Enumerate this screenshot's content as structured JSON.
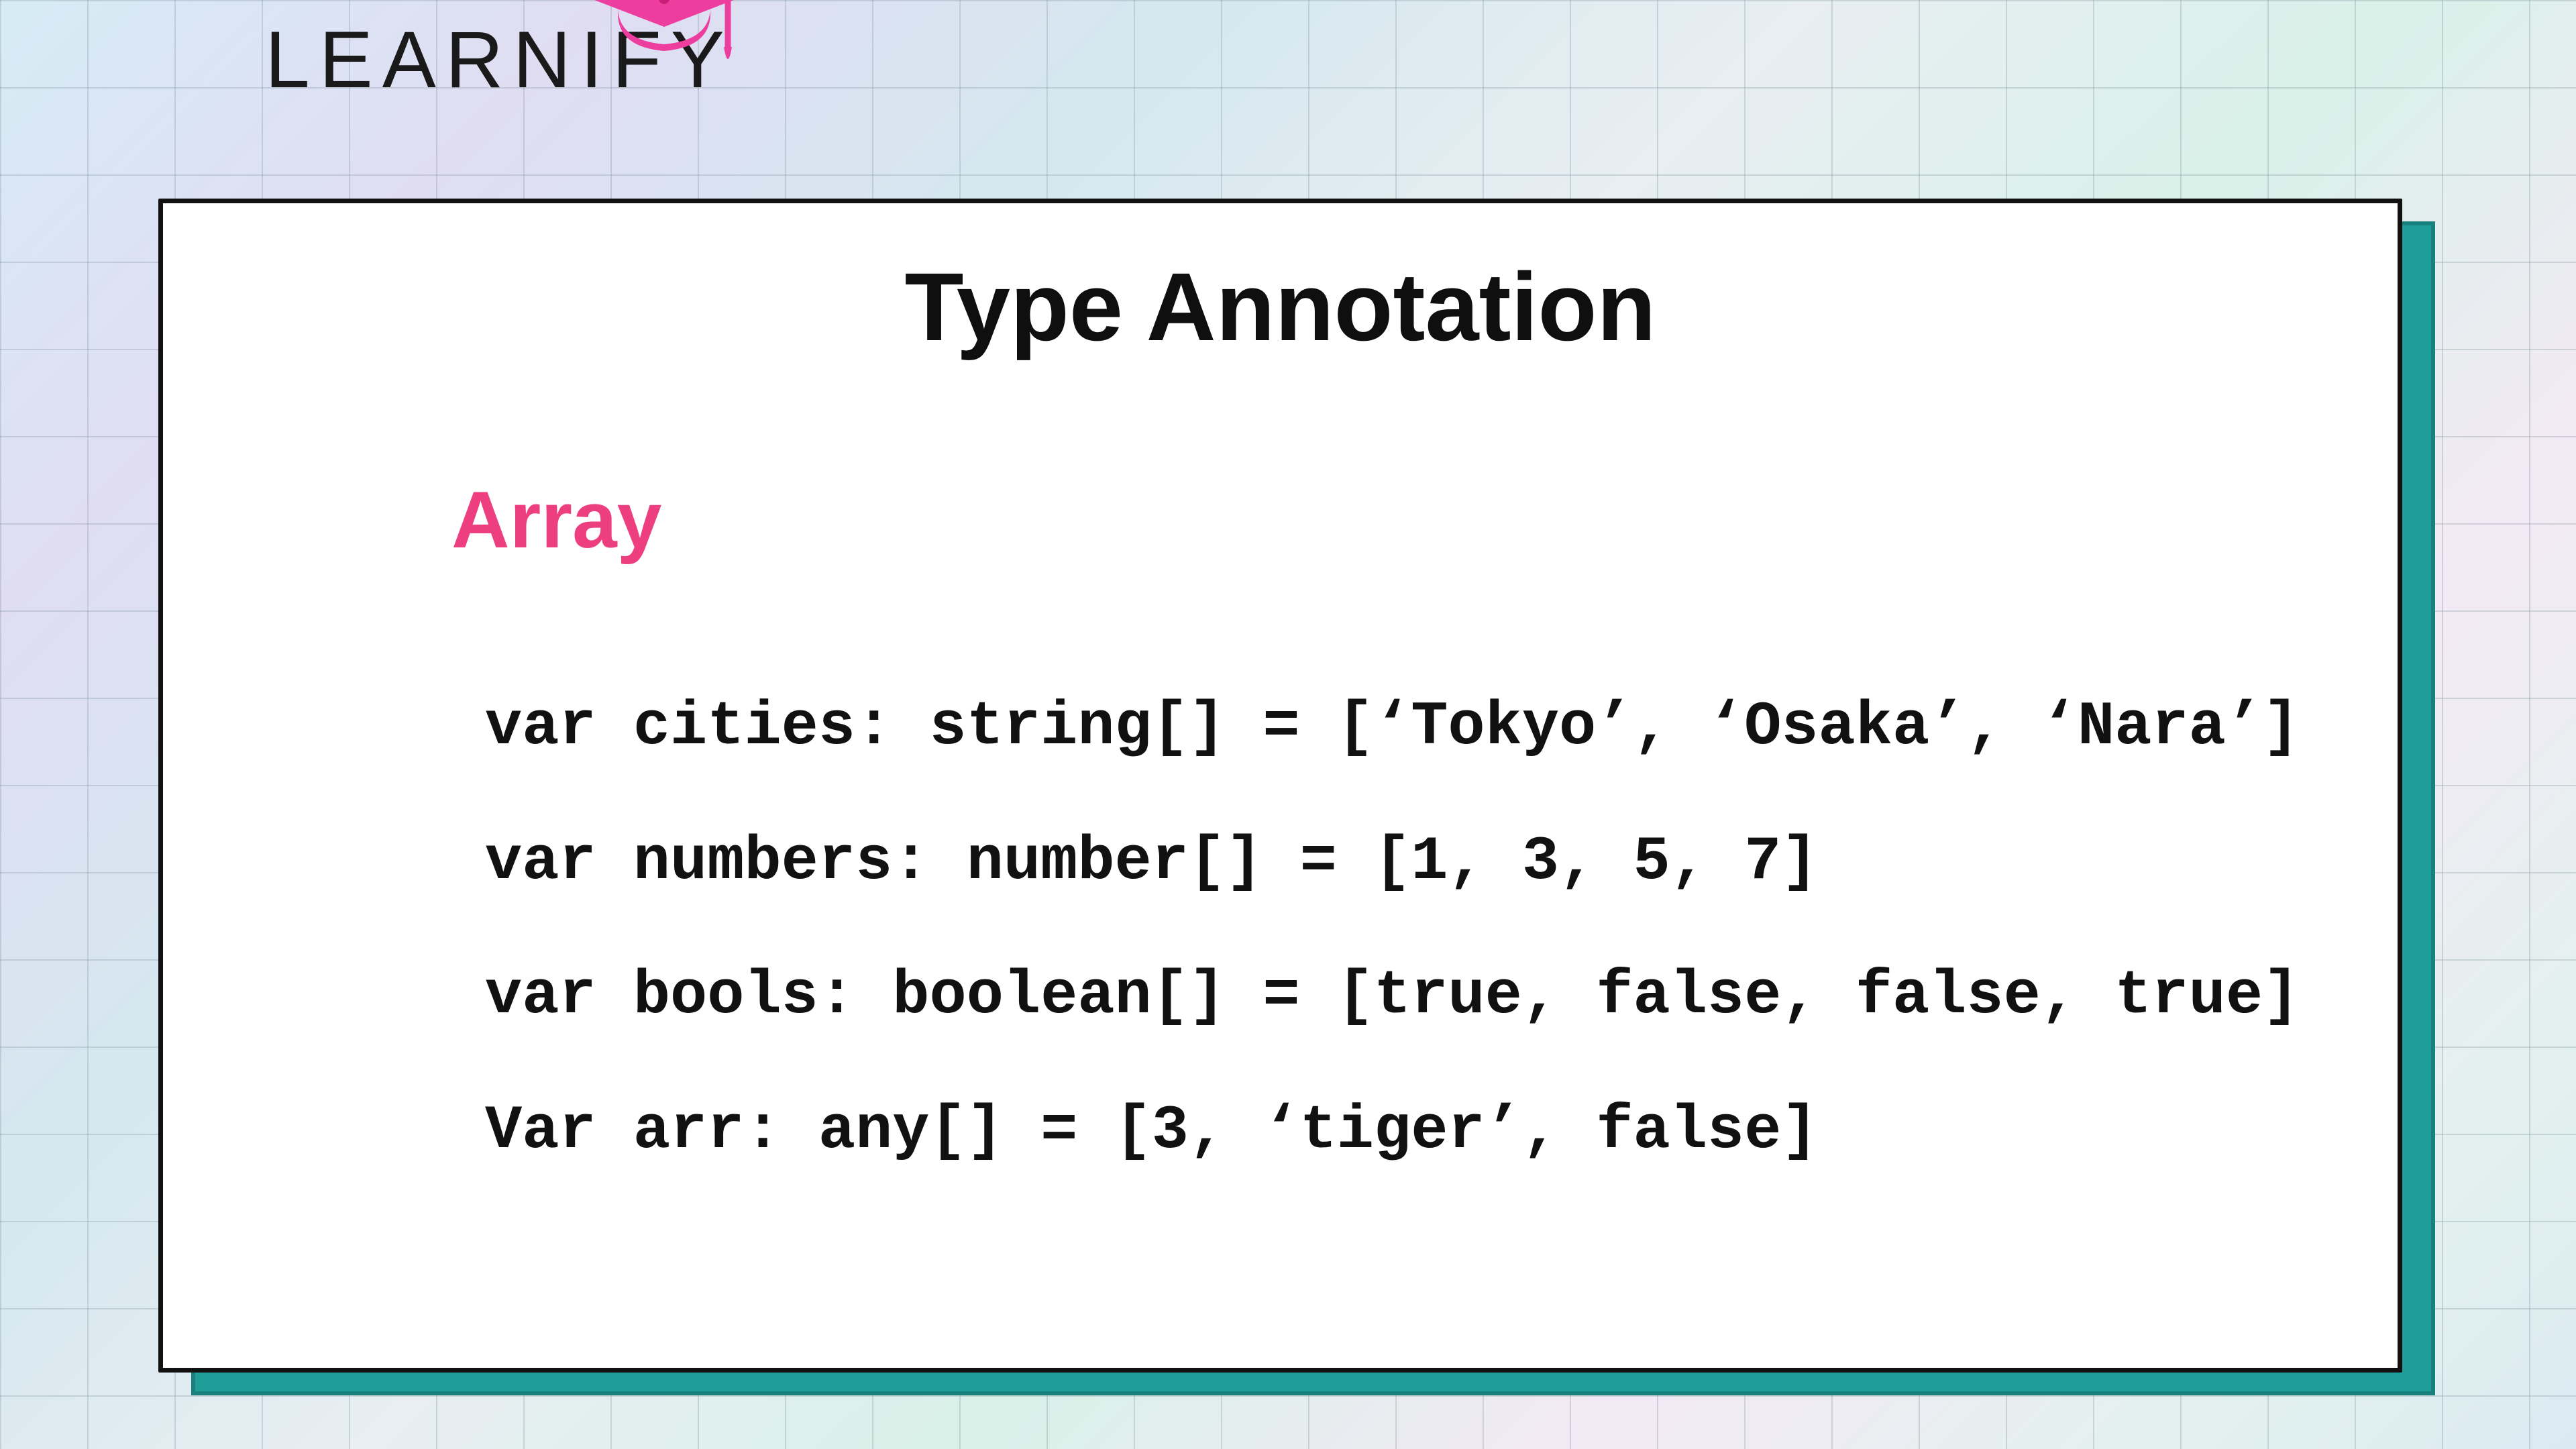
{
  "brand": {
    "name": "LEARNIFY"
  },
  "slide": {
    "title": "Type Annotation",
    "subheading": "Array",
    "code_lines": [
      "var cities: string[] = [‘Tokyo’, ‘Osaka’, ‘Nara’]",
      "var numbers: number[] = [1, 3, 5, 7]",
      "var bools: boolean[] = [true, false, false, true]",
      "Var arr: any[] = [3, ‘tiger’, false]"
    ]
  },
  "colors": {
    "accent": "#ed3f7f",
    "card_shadow": "#1f9e99"
  }
}
